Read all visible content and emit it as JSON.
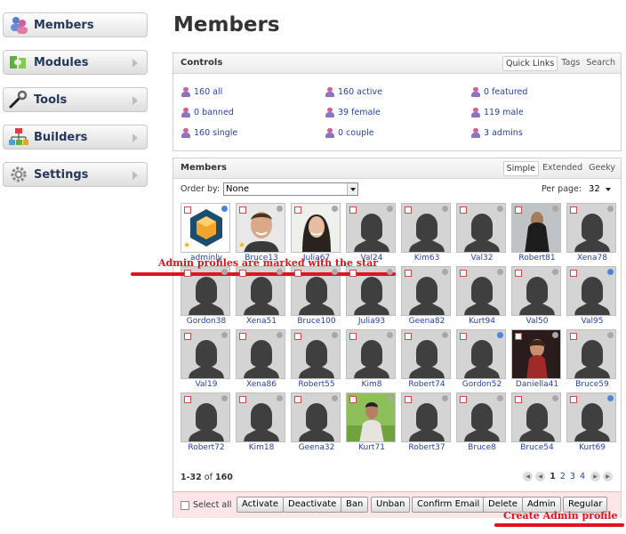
{
  "nav": {
    "items": [
      {
        "label": "Members",
        "icon": "members-icon"
      },
      {
        "label": "Modules",
        "icon": "modules-icon"
      },
      {
        "label": "Tools",
        "icon": "tools-icon"
      },
      {
        "label": "Builders",
        "icon": "builders-icon"
      },
      {
        "label": "Settings",
        "icon": "settings-icon"
      }
    ]
  },
  "page": {
    "title": "Members"
  },
  "controls": {
    "title": "Controls",
    "tabs": [
      "Quick Links",
      "Tags",
      "Search"
    ],
    "links": [
      {
        "label": "160 all"
      },
      {
        "label": "160 active"
      },
      {
        "label": "0 featured"
      },
      {
        "label": "0 banned"
      },
      {
        "label": "39 female"
      },
      {
        "label": "119 male"
      },
      {
        "label": "160 single"
      },
      {
        "label": "0 couple"
      },
      {
        "label": "3 admins"
      }
    ]
  },
  "members": {
    "title": "Members",
    "tabs": [
      "Simple",
      "Extended",
      "Geeky"
    ],
    "order_label": "Order by:",
    "order_value": "None",
    "per_page_label": "Per page:",
    "per_page_value": "32",
    "users": [
      {
        "name": "adminly",
        "photo": "avatar-hexagon",
        "admin": true,
        "online": true
      },
      {
        "name": "Bruce13",
        "photo": "photo-man",
        "admin": true,
        "online": false
      },
      {
        "name": "Julia67",
        "photo": "photo-woman",
        "admin": false,
        "online": false
      },
      {
        "name": "Val24",
        "photo": "placeholder",
        "admin": false,
        "online": false
      },
      {
        "name": "Kim63",
        "photo": "placeholder",
        "admin": false,
        "online": false
      },
      {
        "name": "Val32",
        "photo": "placeholder",
        "admin": false,
        "online": false
      },
      {
        "name": "Robert81",
        "photo": "photo-man-dark",
        "admin": false,
        "online": false
      },
      {
        "name": "Xena78",
        "photo": "placeholder",
        "admin": false,
        "online": false
      },
      {
        "name": "Gordon38",
        "photo": "placeholder",
        "admin": false,
        "online": false
      },
      {
        "name": "Xena51",
        "photo": "placeholder",
        "admin": false,
        "online": false
      },
      {
        "name": "Bruce100",
        "photo": "placeholder",
        "admin": false,
        "online": false
      },
      {
        "name": "Julia93",
        "photo": "placeholder",
        "admin": false,
        "online": false
      },
      {
        "name": "Geena82",
        "photo": "placeholder",
        "admin": false,
        "online": false
      },
      {
        "name": "Kurt94",
        "photo": "placeholder",
        "admin": false,
        "online": false
      },
      {
        "name": "Val50",
        "photo": "placeholder",
        "admin": false,
        "online": false
      },
      {
        "name": "Val95",
        "photo": "placeholder",
        "admin": false,
        "online": true
      },
      {
        "name": "Val19",
        "photo": "placeholder",
        "admin": false,
        "online": false
      },
      {
        "name": "Xena86",
        "photo": "placeholder",
        "admin": false,
        "online": false
      },
      {
        "name": "Robert55",
        "photo": "placeholder",
        "admin": false,
        "online": false
      },
      {
        "name": "Kim8",
        "photo": "placeholder",
        "admin": false,
        "online": false
      },
      {
        "name": "Robert74",
        "photo": "placeholder",
        "admin": false,
        "online": false
      },
      {
        "name": "Gordon52",
        "photo": "placeholder",
        "admin": false,
        "online": true
      },
      {
        "name": "Daniella41",
        "photo": "photo-woman-red",
        "admin": false,
        "online": false
      },
      {
        "name": "Bruce59",
        "photo": "placeholder",
        "admin": false,
        "online": false
      },
      {
        "name": "Robert72",
        "photo": "placeholder",
        "admin": false,
        "online": false
      },
      {
        "name": "Kim18",
        "photo": "placeholder",
        "admin": false,
        "online": false
      },
      {
        "name": "Geena32",
        "photo": "placeholder",
        "admin": false,
        "online": false
      },
      {
        "name": "Kurt71",
        "photo": "photo-man-field",
        "admin": false,
        "online": false
      },
      {
        "name": "Robert37",
        "photo": "placeholder",
        "admin": false,
        "online": false
      },
      {
        "name": "Bruce8",
        "photo": "placeholder",
        "admin": false,
        "online": false
      },
      {
        "name": "Bruce54",
        "photo": "placeholder",
        "admin": false,
        "online": false
      },
      {
        "name": "Kurt69",
        "photo": "placeholder",
        "admin": false,
        "online": true
      }
    ],
    "range_start": "1-32",
    "range_of": " of ",
    "total": "160",
    "pages": [
      "1",
      "2",
      "3",
      "4"
    ],
    "current_page": "1"
  },
  "actions": {
    "select_all": "Select all",
    "buttons": [
      "Activate",
      "Deactivate",
      "Ban",
      "Unban",
      "Confirm Email",
      "Delete",
      "Admin",
      "Regular"
    ]
  },
  "annotations": {
    "star_note": "Admin profiles are marked with the star",
    "admin_note": "Create Admin profile",
    "color": "#e0141f"
  },
  "colors": {
    "link": "#2741a6",
    "action_bar": "#fde6e7",
    "admin_star": "#f5b800",
    "online_dot": "#4a86d8"
  }
}
